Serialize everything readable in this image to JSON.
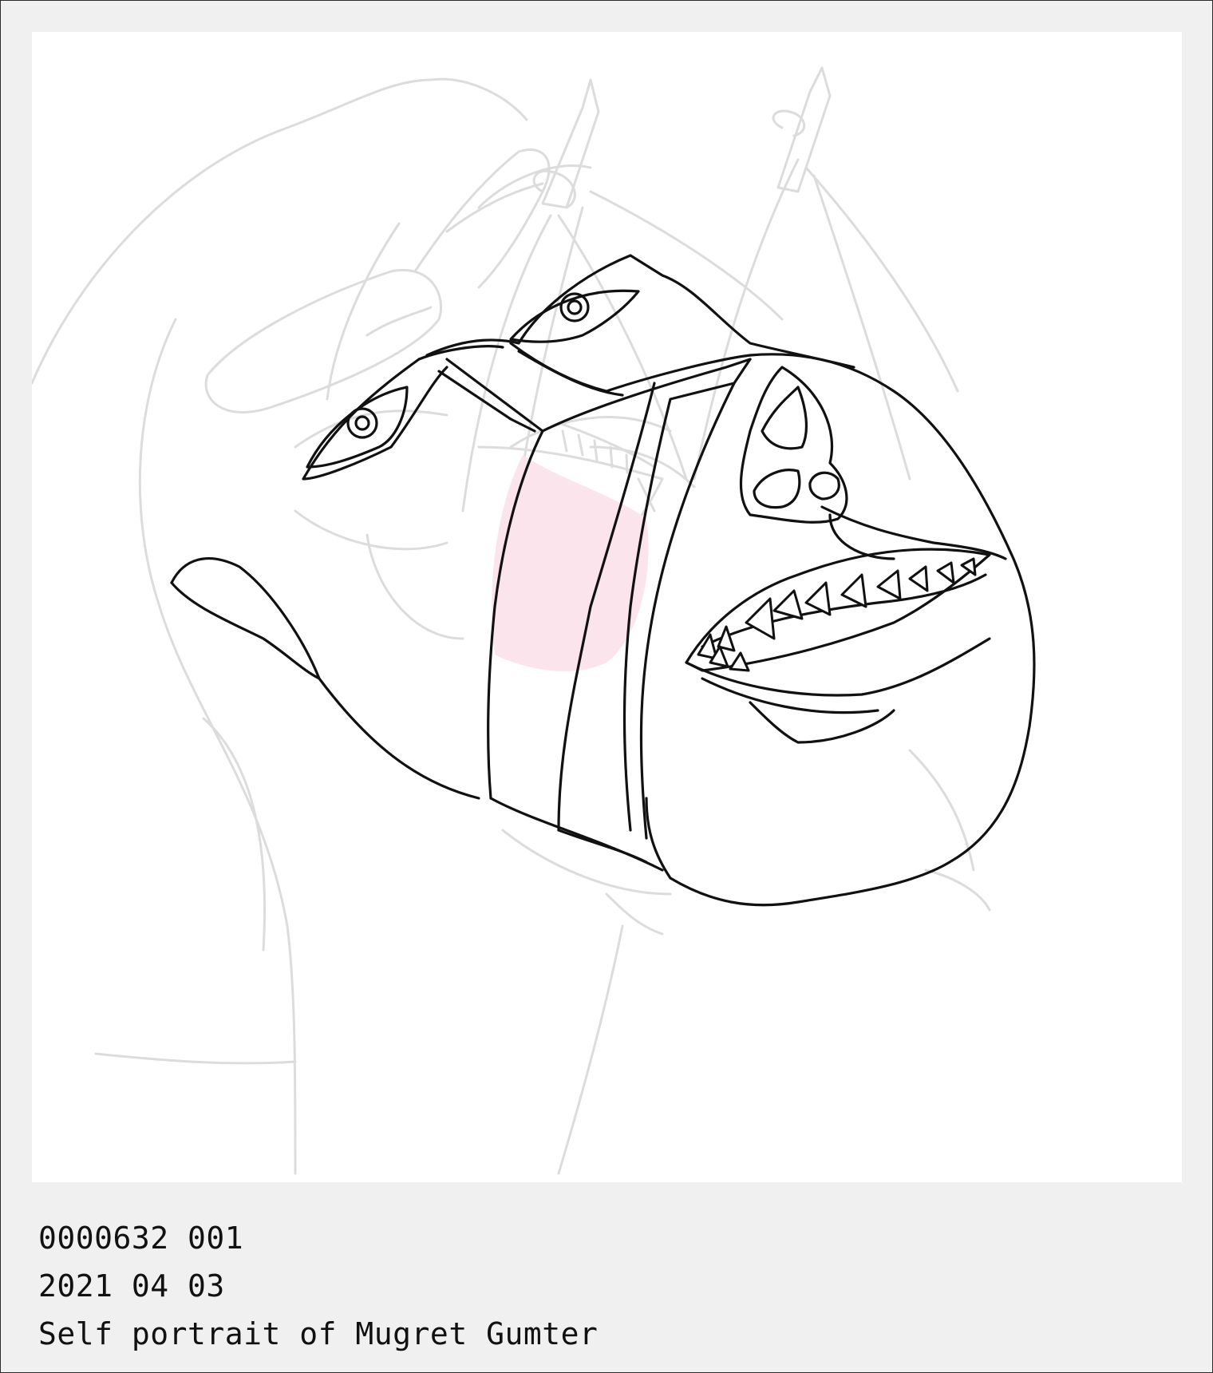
{
  "artwork": {
    "icon": "sketch-portrait-drawing",
    "colors": {
      "background": "#f0f0f0",
      "paper": "#ffffff",
      "line": "#111111",
      "sketch": "#dcdcdc",
      "tongue": "#fbe4ec"
    }
  },
  "caption": {
    "id_line": "0000632 001",
    "date_line": "2021 04 03",
    "title_line": "Self portrait of Mugret Gumter"
  }
}
